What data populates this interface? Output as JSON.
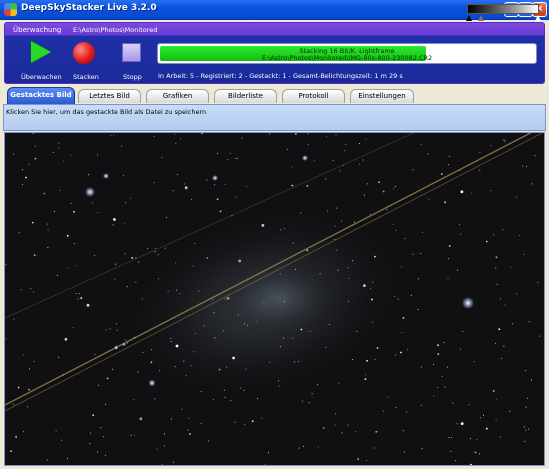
{
  "window": {
    "title": "DeepSkyStacker Live 3.2.0",
    "min_glyph": "_",
    "max_glyph": "□",
    "close_glyph": "×"
  },
  "monitor": {
    "label": "Überwachung",
    "path": "E:\\Astro\\Photos\\Monitored",
    "buttons": {
      "watch": "Überwachen",
      "stack": "Stacken",
      "stop": "Stopp"
    },
    "progress": {
      "line1": "Stacking 16 Bit/K. Lightframe",
      "line2": "E:\\Astro\\Photos\\Monitored\\IMG-90s-800-230082.CR2",
      "fraction": 0.71
    },
    "status": "In Arbeit: 5 - Registriert: 2 - Gestackt: 1 - Gesamt-Belichtungszeit: 1 m 29 s"
  },
  "tabs": [
    {
      "label": "Gestacktes Bild",
      "active": true
    },
    {
      "label": "Letztes Bild",
      "active": false
    },
    {
      "label": "Grafiken",
      "active": false
    },
    {
      "label": "Bilderliste",
      "active": false
    },
    {
      "label": "Protokoll",
      "active": false
    },
    {
      "label": "Einstellungen",
      "active": false
    }
  ],
  "info": {
    "hint": "Klicken Sie hier, um das gestackte Bild als Datei zu speichern"
  },
  "colors": {
    "progress": "#10c010",
    "panel": "#1b2a9a",
    "tab_active": "#2a5ad0",
    "satellite_trail": "#a08a50"
  }
}
